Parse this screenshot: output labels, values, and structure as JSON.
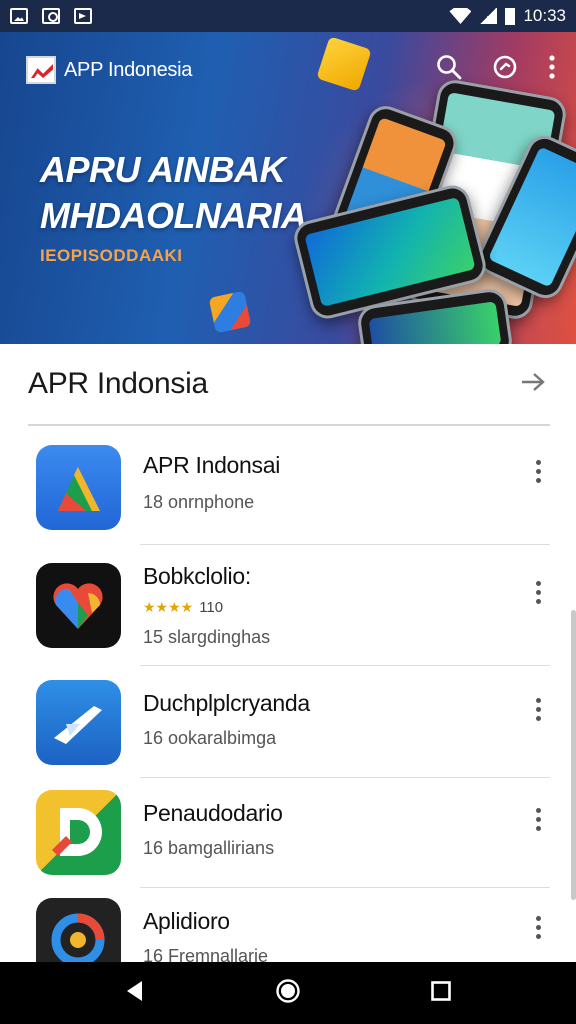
{
  "status_bar": {
    "time": "10:33",
    "icons": [
      "gallery-icon",
      "camera-icon",
      "download-icon",
      "wifi-icon",
      "signal-icon",
      "battery-icon"
    ]
  },
  "banner": {
    "app_title": "APP Indonesia",
    "headline_line1": "APRU AINBAK",
    "headline_line2": "MHDAOLNARIA",
    "tagline": "IEOPISODDAAKI",
    "actions": [
      "search-icon",
      "refresh-icon",
      "more-vert-icon"
    ],
    "colors": {
      "start": "#17468f",
      "end": "#e0503e",
      "tagline": "#f6a34a"
    }
  },
  "section": {
    "title": "APR Indonsia"
  },
  "apps": [
    {
      "name": "APR Indonsai",
      "subtitle": "18 onrnphone",
      "icon": "triangle-app-icon"
    },
    {
      "name": "Bobkclolio:",
      "rating": "110",
      "subtitle": "15 slargdinghas",
      "icon": "heart-app-icon"
    },
    {
      "name": "Duchplplcryanda",
      "subtitle": "16 ookaralbimga",
      "icon": "plane-app-icon"
    },
    {
      "name": "Penaudodario",
      "subtitle": "16 bamgallirians",
      "icon": "letter-d-app-icon"
    },
    {
      "name": "Aplidioro",
      "subtitle": "16 Fremnallarie",
      "icon": "swirl-app-icon"
    }
  ],
  "nav_bar": {
    "buttons": [
      "back-icon",
      "home-icon",
      "recents-icon"
    ]
  }
}
